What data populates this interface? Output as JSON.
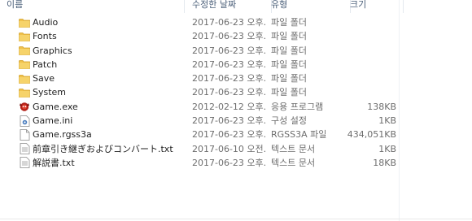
{
  "columns": {
    "name": "이름",
    "date": "수정한 날짜",
    "type": "유형",
    "size": "크기"
  },
  "files": [
    {
      "icon": "folder-icon",
      "name": "Audio",
      "date": "2017-06-23 오후...",
      "type": "파일 폴더",
      "size": ""
    },
    {
      "icon": "folder-icon",
      "name": "Fonts",
      "date": "2017-06-23 오후...",
      "type": "파일 폴더",
      "size": ""
    },
    {
      "icon": "folder-icon",
      "name": "Graphics",
      "date": "2017-06-23 오후...",
      "type": "파일 폴더",
      "size": ""
    },
    {
      "icon": "folder-icon",
      "name": "Patch",
      "date": "2017-06-23 오후...",
      "type": "파일 폴더",
      "size": ""
    },
    {
      "icon": "folder-icon",
      "name": "Save",
      "date": "2017-06-23 오후...",
      "type": "파일 폴더",
      "size": ""
    },
    {
      "icon": "folder-icon",
      "name": "System",
      "date": "2017-06-23 오후...",
      "type": "파일 폴더",
      "size": ""
    },
    {
      "icon": "game-exe-icon",
      "name": "Game.exe",
      "date": "2012-02-12 오후...",
      "type": "응용 프로그램",
      "size": "138KB"
    },
    {
      "icon": "settings-file-icon",
      "name": "Game.ini",
      "date": "2017-06-23 오후...",
      "type": "구성 설정",
      "size": "1KB"
    },
    {
      "icon": "document-icon",
      "name": "Game.rgss3a",
      "date": "2017-06-23 오후...",
      "type": "RGSS3A 파일",
      "size": "434,051KB"
    },
    {
      "icon": "text-file-icon",
      "name": "前章引き継ぎおよびコンバート.txt",
      "date": "2017-06-10 오전...",
      "type": "텍스트 문서",
      "size": "1KB"
    },
    {
      "icon": "text-file-icon",
      "name": "解説書.txt",
      "date": "2017-06-23 오후...",
      "type": "텍스트 문서",
      "size": "18KB"
    }
  ],
  "colors": {
    "header_text": "#4c607a",
    "meta_text": "#6d6d6d",
    "folder": "#f0c14b"
  }
}
